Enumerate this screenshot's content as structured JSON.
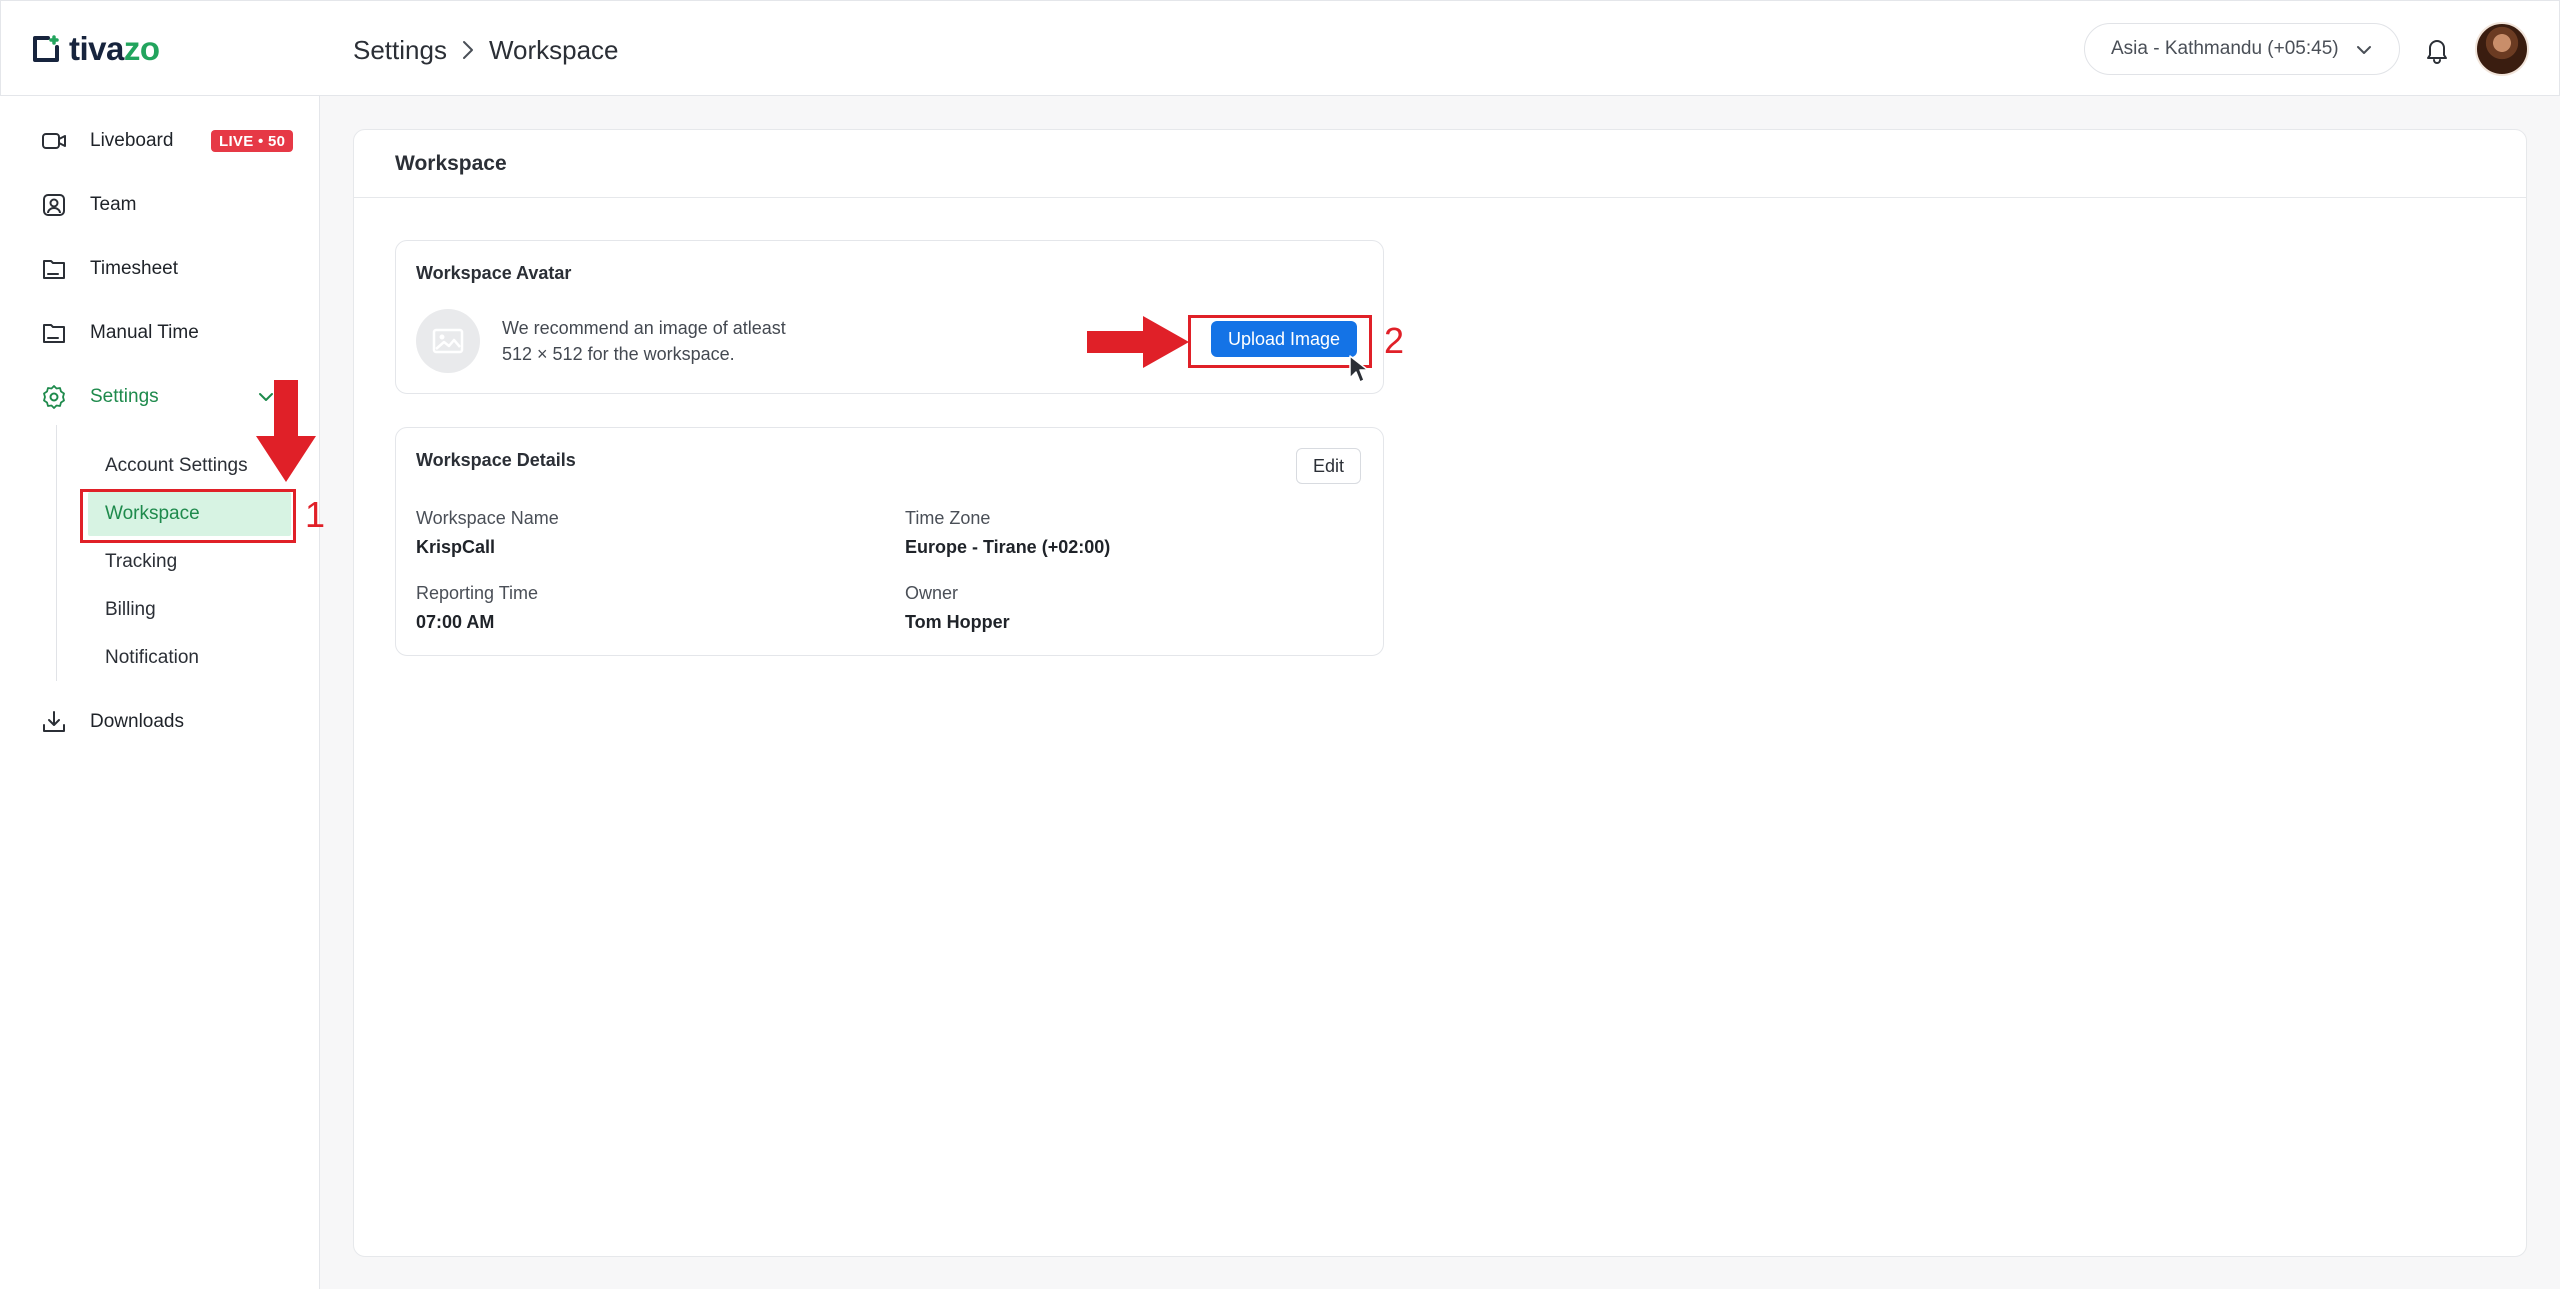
{
  "app": {
    "logo_text_dark": "tiva",
    "logo_text_green": "zo"
  },
  "header": {
    "breadcrumb": [
      "Settings",
      "Workspace"
    ],
    "timezone_select": "Asia - Kathmandu (+05:45)",
    "icons": [
      "chevron-right-icon",
      "chevron-down-icon",
      "bell-icon",
      "user-avatar"
    ]
  },
  "sidebar": {
    "items": [
      {
        "label": "Liveboard",
        "icon": "liveboard-icon",
        "badge": "LIVE • 50"
      },
      {
        "label": "Team",
        "icon": "team-icon"
      },
      {
        "label": "Timesheet",
        "icon": "timesheet-icon"
      },
      {
        "label": "Manual Time",
        "icon": "manual-time-icon"
      },
      {
        "label": "Settings",
        "icon": "gear-icon",
        "expanded": true
      },
      {
        "label": "Downloads",
        "icon": "download-icon"
      }
    ],
    "settings_subitems": [
      {
        "label": "Account Settings"
      },
      {
        "label": "Workspace",
        "active": true
      },
      {
        "label": "Tracking"
      },
      {
        "label": "Billing"
      },
      {
        "label": "Notification"
      }
    ]
  },
  "main": {
    "panel_title": "Workspace",
    "avatar_card": {
      "title": "Workspace Avatar",
      "recommendation_line1": "We recommend an image of atleast",
      "recommendation_line2": "512 × 512 for the workspace.",
      "upload_label": "Upload Image"
    },
    "details_card": {
      "title": "Workspace Details",
      "edit_label": "Edit",
      "fields": [
        {
          "label": "Workspace Name",
          "value": "KrispCall"
        },
        {
          "label": "Time Zone",
          "value": "Europe - Tirane (+02:00)"
        },
        {
          "label": "Reporting Time",
          "value": "07:00 AM"
        },
        {
          "label": "Owner",
          "value": "Tom Hopper"
        }
      ]
    }
  },
  "annotations": {
    "step1": "1",
    "step2": "2",
    "color": "#e02028"
  },
  "colors": {
    "brand_green": "#22a45d",
    "active_green": "#1e8a4c",
    "active_bg": "#d7f3e3",
    "primary_blue": "#1473e6",
    "live_red": "#e63946"
  }
}
